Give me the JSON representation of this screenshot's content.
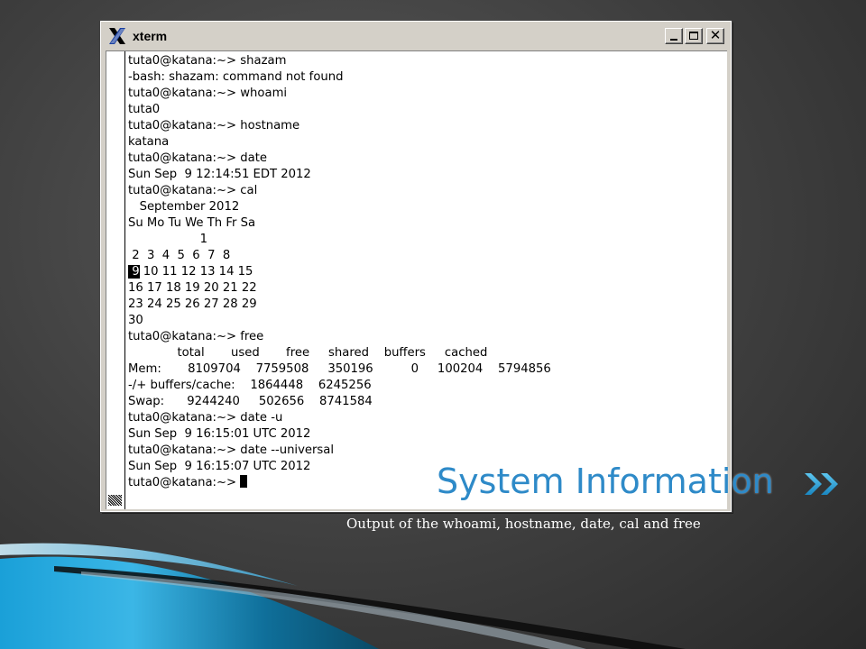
{
  "window": {
    "title": "xterm",
    "buttons": {
      "minimize": "_",
      "maximize": "□",
      "close": "✕"
    }
  },
  "terminal": {
    "lines": [
      "tuta0@katana:~> shazam",
      "-bash: shazam: command not found",
      "tuta0@katana:~> whoami",
      "tuta0",
      "tuta0@katana:~> hostname",
      "katana",
      "tuta0@katana:~> date",
      "Sun Sep  9 12:14:51 EDT 2012",
      "tuta0@katana:~> cal",
      "   September 2012",
      "Su Mo Tu We Th Fr Sa",
      "                   1",
      " 2  3  4  5  6  7  8",
      "10 11 12 13 14 15",
      "16 17 18 19 20 21 22",
      "23 24 25 26 27 28 29",
      "30",
      "tuta0@katana:~> free",
      "             total       used       free     shared    buffers     cached",
      "Mem:       8109704    7759508     350196          0     100204    5794856",
      "-/+ buffers/cache:    1864448    6245256",
      "Swap:      9244240     502656    8741584",
      "tuta0@katana:~> date -u",
      "Sun Sep  9 16:15:01 UTC 2012",
      "tuta0@katana:~> date --universal",
      "Sun Sep  9 16:15:07 UTC 2012",
      "tuta0@katana:~> "
    ],
    "highlighted_day": " 9"
  },
  "slide": {
    "title": "System Information",
    "caption": "Output of the whoami, hostname, date,  cal and free"
  },
  "colors": {
    "title": "#2e8ac8",
    "accent": "#1ea4dc"
  },
  "icons": {
    "window_icon": "x-logo-icon",
    "bullet": "double-chevron-icon"
  }
}
